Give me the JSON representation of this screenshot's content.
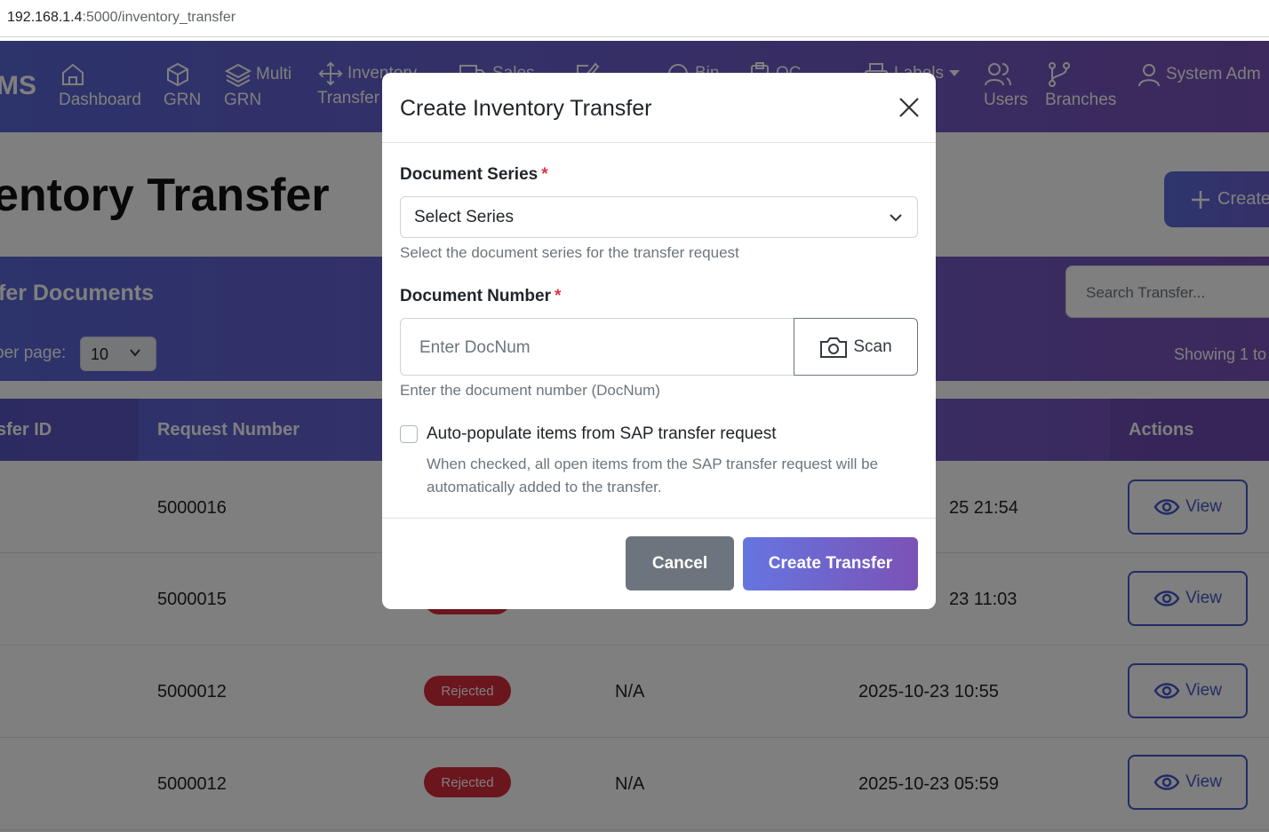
{
  "browser": {
    "url_host": "192.168.1.4",
    "url_path": ":5000/inventory_transfer"
  },
  "navbar": {
    "brand": "MS",
    "items": [
      {
        "label": "Dashboard",
        "icon": "home-icon"
      },
      {
        "label": "GRN",
        "icon": "box-icon"
      },
      {
        "label_top": "Multi",
        "label": "GRN",
        "icon": "layers-icon"
      },
      {
        "label_top": "Inventory",
        "label": "Transfer",
        "icon": "move-icon"
      },
      {
        "label_top": "Sales",
        "icon": "truck-icon"
      },
      {
        "label_top": "Bin",
        "icon": "search-icon"
      },
      {
        "label_top": "QC",
        "icon": "clipboard-icon"
      },
      {
        "label_top": "Labels",
        "icon": "printer-icon"
      },
      {
        "label": "Users",
        "icon": "users-icon"
      },
      {
        "label": "Branches",
        "icon": "branch-icon"
      },
      {
        "label_top": "System Adm",
        "icon": "user-icon"
      }
    ]
  },
  "page": {
    "title": "entory Transfer",
    "create_button": "Create"
  },
  "card": {
    "title": "fer Documents",
    "per_page_label": "per page:",
    "per_page_value": "10",
    "search_placeholder": "Search Transfer...",
    "showing_text": "Showing 1 to"
  },
  "table": {
    "headers": [
      "sfer ID",
      "Request Number",
      "Actions"
    ],
    "rows": [
      {
        "request_number": "5000016",
        "status": "",
        "n_a": "",
        "date": "25 21:54",
        "action": "View"
      },
      {
        "request_number": "5000015",
        "status": "",
        "n_a": "",
        "date": "23 11:03",
        "action": "View"
      },
      {
        "request_number": "5000012",
        "status": "Rejected",
        "n_a": "N/A",
        "date": "2025-10-23 10:55",
        "action": "View"
      },
      {
        "request_number": "5000012",
        "status": "Rejected",
        "n_a": "N/A",
        "date": "2025-10-23 05:59",
        "action": "View"
      }
    ]
  },
  "modal": {
    "title": "Create Inventory Transfer",
    "series_label": "Document Series",
    "series_value": "Select Series",
    "series_help": "Select the document series for the transfer request",
    "docnum_label": "Document Number",
    "docnum_placeholder": "Enter DocNum",
    "scan_label": "Scan",
    "docnum_help": "Enter the document number (DocNum)",
    "auto_label": "Auto-populate items from SAP transfer request",
    "auto_help": "When checked, all open items from the SAP transfer request will be automatically added to the transfer.",
    "cancel_label": "Cancel",
    "create_label": "Create Transfer",
    "required_mark": "*"
  },
  "colors": {
    "primary": "#5a66d6",
    "accent": "#7a52b8",
    "danger": "#d62b3a",
    "secondary": "#6c757d"
  }
}
